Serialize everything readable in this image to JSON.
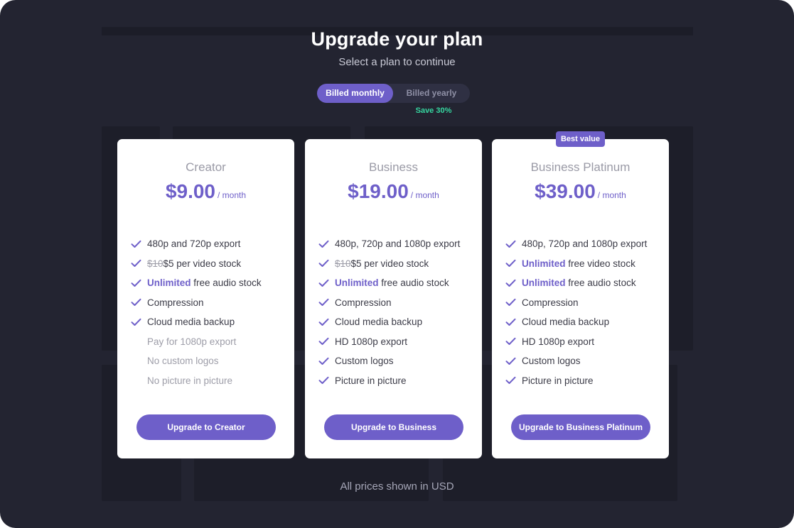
{
  "header": {
    "title": "Upgrade your plan",
    "subtitle": "Select a plan to continue"
  },
  "billing_toggle": {
    "monthly_label": "Billed monthly",
    "yearly_label": "Billed yearly",
    "selected": "monthly",
    "save_note": "Save 30%"
  },
  "plans": [
    {
      "name": "Creator",
      "price": "$9.00",
      "period": "/ month",
      "features": [
        {
          "text": "480p and 720p export",
          "included": true
        },
        {
          "strike": "$10",
          "text": "$5 per video stock",
          "included": true
        },
        {
          "highlight": "Unlimited",
          "text": " free audio stock",
          "included": true
        },
        {
          "text": "Compression",
          "included": true
        },
        {
          "text": "Cloud media backup",
          "included": true
        },
        {
          "text": "Pay for 1080p export",
          "included": false
        },
        {
          "text": "No custom logos",
          "included": false
        },
        {
          "text": "No picture in picture",
          "included": false
        }
      ],
      "cta": "Upgrade to Creator"
    },
    {
      "name": "Business",
      "price": "$19.00",
      "period": "/ month",
      "features": [
        {
          "text": "480p, 720p and 1080p export",
          "included": true
        },
        {
          "strike": "$10",
          "text": "$5 per video stock",
          "included": true
        },
        {
          "highlight": "Unlimited",
          "text": " free audio stock",
          "included": true
        },
        {
          "text": "Compression",
          "included": true
        },
        {
          "text": "Cloud media backup",
          "included": true
        },
        {
          "text": "HD 1080p export",
          "included": true
        },
        {
          "text": "Custom logos",
          "included": true
        },
        {
          "text": "Picture in picture",
          "included": true
        }
      ],
      "cta": "Upgrade to Business"
    },
    {
      "name": "Business Platinum",
      "badge": "Best value",
      "price": "$39.00",
      "period": "/ month",
      "features": [
        {
          "text": "480p, 720p and 1080p export",
          "included": true
        },
        {
          "highlight": "Unlimited",
          "text": " free video stock",
          "included": true
        },
        {
          "highlight": "Unlimited",
          "text": " free audio stock",
          "included": true
        },
        {
          "text": "Compression",
          "included": true
        },
        {
          "text": "Cloud media backup",
          "included": true
        },
        {
          "text": "HD 1080p export",
          "included": true
        },
        {
          "text": "Custom logos",
          "included": true
        },
        {
          "text": "Picture in picture",
          "included": true
        }
      ],
      "cta": "Upgrade to Business Platinum"
    }
  ],
  "footer": "All prices shown in USD",
  "icons": {
    "feature_check": "check-icon"
  },
  "colors": {
    "accent": "#6e5fc9",
    "save_note": "#36d6a0",
    "overlay_bg": "#232431"
  }
}
